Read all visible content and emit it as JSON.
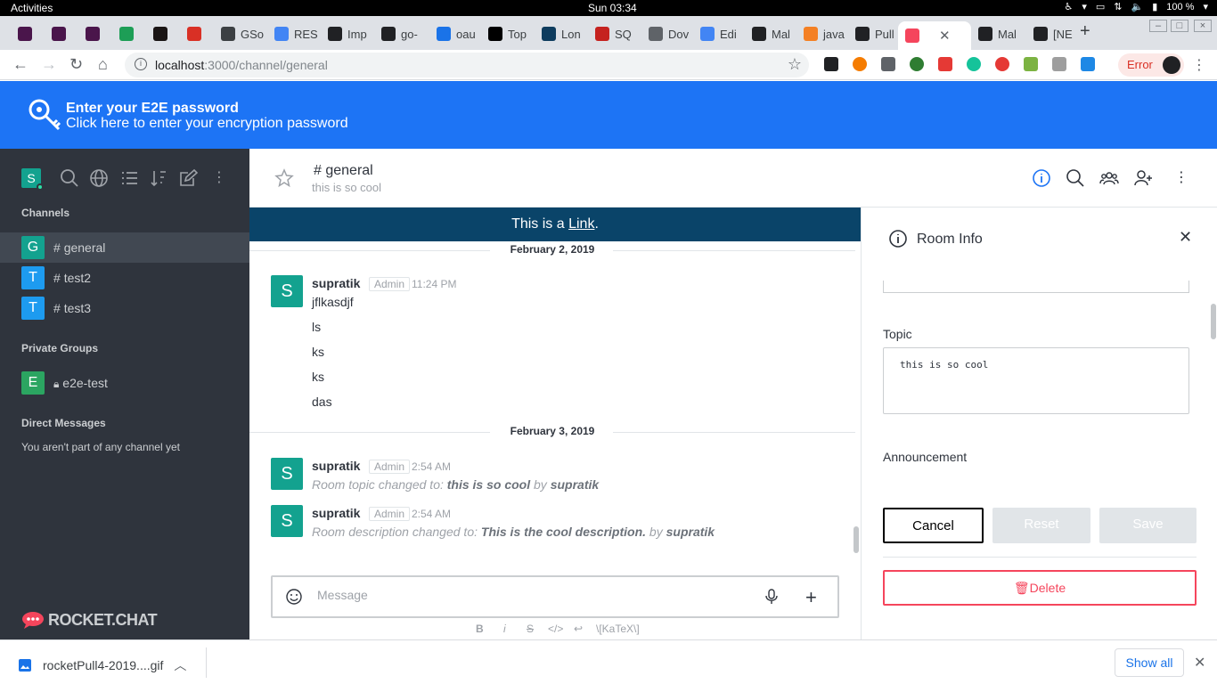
{
  "os": {
    "activities": "Activities",
    "clock": "Sun 03:34",
    "battery": "100 %"
  },
  "browser": {
    "tabs": [
      {
        "label": "",
        "color": "#4a154b"
      },
      {
        "label": "",
        "color": "#4a154b"
      },
      {
        "label": "",
        "color": "#4a154b"
      },
      {
        "label": "",
        "color": "#1d9e56"
      },
      {
        "label": "",
        "color": "#191414"
      },
      {
        "label": "",
        "color": "#d93025"
      },
      {
        "label": "GSo",
        "color": "#3c4043"
      },
      {
        "label": "RES",
        "color": "#4285f4"
      },
      {
        "label": "Imp",
        "color": "#202124"
      },
      {
        "label": "go-",
        "color": "#202124"
      },
      {
        "label": "oau",
        "color": "#1a73e8"
      },
      {
        "label": "Top",
        "color": "#000000"
      },
      {
        "label": "Lon",
        "color": "#0e3c5e"
      },
      {
        "label": "SQ",
        "color": "#c5221f"
      },
      {
        "label": "Dov",
        "color": "#5f6368"
      },
      {
        "label": "Edi",
        "color": "#4285f4"
      },
      {
        "label": "Mal",
        "color": "#202124"
      },
      {
        "label": "java",
        "color": "#f48024"
      },
      {
        "label": "Pull",
        "color": "#202124"
      },
      {
        "label": "",
        "color": "#f5455c",
        "active": true
      },
      {
        "label": "Mal",
        "color": "#202124"
      },
      {
        "label": "[NE",
        "color": "#202124"
      }
    ],
    "url_host": "localhost",
    "url_path": ":3000/channel/general",
    "error_label": "Error"
  },
  "e2e_banner": {
    "title": "Enter your E2E password",
    "subtitle": "Click here to enter your encryption password"
  },
  "sidebar": {
    "user_initial": "S",
    "sections": {
      "channels": "Channels",
      "private_groups": "Private Groups",
      "direct_messages": "Direct Messages"
    },
    "channels": [
      {
        "initial": "G",
        "name": "general",
        "color": "#13a28f"
      },
      {
        "initial": "T",
        "name": "test2",
        "color": "#1d9bf0"
      },
      {
        "initial": "T",
        "name": "test3",
        "color": "#1d9bf0"
      }
    ],
    "groups": [
      {
        "initial": "E",
        "name": "e2e-test",
        "color": "#2ba561"
      }
    ],
    "dm_empty": "You aren't part of any channel yet",
    "logo_text": "ROCKET.CHAT"
  },
  "room": {
    "name": "general",
    "topic": "this is so cool",
    "announcement_prefix": "This is a ",
    "announcement_link": "Link",
    "announcement_suffix": "."
  },
  "messages": {
    "date1": "February 2, 2019",
    "date2": "February 3, 2019",
    "msg1": {
      "initial": "S",
      "user": "supratik",
      "role": "Admin",
      "time": "11:24 PM",
      "lines": [
        "jflkasdjf",
        "ls",
        "ks",
        "ks",
        "das"
      ]
    },
    "msg2": {
      "initial": "S",
      "user": "supratik",
      "role": "Admin",
      "time": "2:54 AM",
      "prefix": "Room topic changed to: ",
      "value": "this is so cool",
      "by": " by ",
      "actor": "supratik"
    },
    "msg3": {
      "initial": "S",
      "user": "supratik",
      "role": "Admin",
      "time": "2:54 AM",
      "prefix": "Room description changed to: ",
      "value": "This is the cool description.",
      "by": " by ",
      "actor": "supratik"
    }
  },
  "composer": {
    "placeholder": "Message",
    "format_bold": "B",
    "format_italic": "i",
    "format_strike": "S",
    "format_code": "</>",
    "format_enter": "↩",
    "format_katex": "\\[KaTeX\\]"
  },
  "room_info": {
    "title": "Room Info",
    "topic_label": "Topic",
    "topic_value": "this is so cool",
    "announcement_label": "Announcement",
    "cancel": "Cancel",
    "reset": "Reset",
    "save": "Save",
    "delete": "Delete"
  },
  "downloads": {
    "file": "rocketPull4-2019....gif",
    "show_all": "Show all"
  },
  "colors": {
    "banner": "#1d74f5",
    "sidebar": "#2f343d",
    "announcement": "#0a4469",
    "danger": "#f5455c"
  }
}
